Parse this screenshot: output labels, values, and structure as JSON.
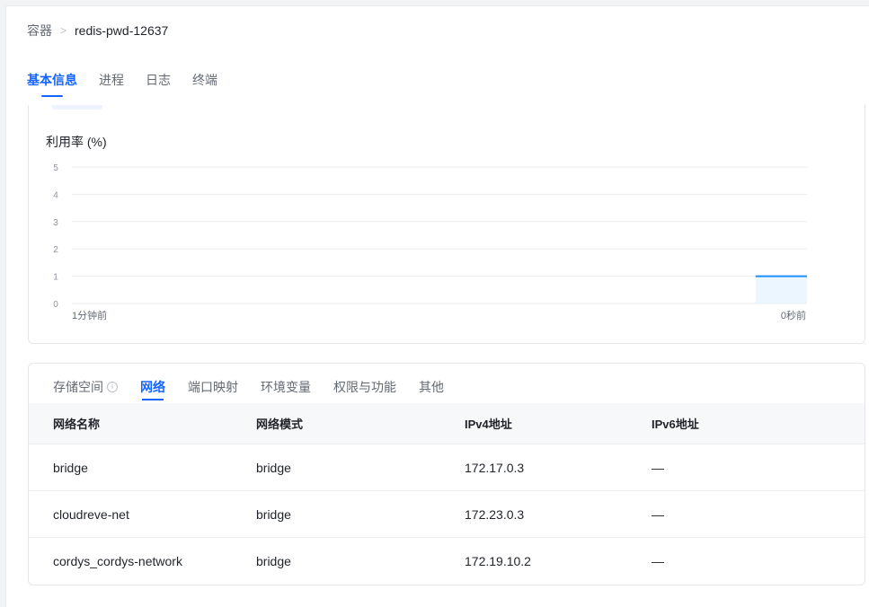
{
  "breadcrumb": {
    "root": "容器",
    "separator": ">",
    "current": "redis-pwd-12637"
  },
  "main_tabs": [
    {
      "label": "基本信息",
      "active": true
    },
    {
      "label": "进程",
      "active": false
    },
    {
      "label": "日志",
      "active": false
    },
    {
      "label": "终端",
      "active": false
    }
  ],
  "chart": {
    "title": "利用率 (%)",
    "accent_color": "#1890ff",
    "fill_color": "#e6f4ff"
  },
  "chart_data": {
    "type": "area",
    "title": "利用率 (%)",
    "ylim": [
      0,
      5
    ],
    "y_ticks": [
      "0",
      "1",
      "2",
      "3",
      "4",
      "5"
    ],
    "x_tick_labels": [
      "1分钟前",
      "0秒前"
    ],
    "grid": true,
    "series": [
      {
        "x": [
          0.93,
          1.0
        ],
        "values": [
          1.0,
          1.0
        ]
      }
    ]
  },
  "network_card": {
    "tabs": [
      {
        "label": "存储空间",
        "info_icon": true,
        "active": false
      },
      {
        "label": "网络",
        "active": true
      },
      {
        "label": "端口映射",
        "active": false
      },
      {
        "label": "环境变量",
        "active": false
      },
      {
        "label": "权限与功能",
        "active": false
      },
      {
        "label": "其他",
        "active": false
      }
    ],
    "columns": [
      "网络名称",
      "网络模式",
      "IPv4地址",
      "IPv6地址"
    ],
    "rows": [
      [
        "bridge",
        "bridge",
        "172.17.0.3",
        "—"
      ],
      [
        "cloudreve-net",
        "bridge",
        "172.23.0.3",
        "—"
      ],
      [
        "cordys_cordys-network",
        "bridge",
        "172.19.10.2",
        "—"
      ]
    ]
  }
}
